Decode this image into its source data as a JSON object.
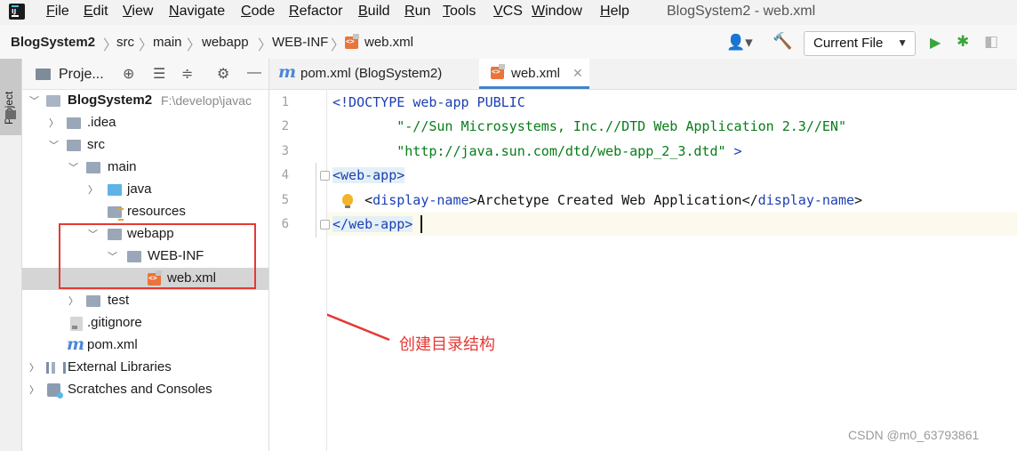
{
  "menu": {
    "items": [
      {
        "key": "F",
        "rest": "ile"
      },
      {
        "key": "E",
        "rest": "dit"
      },
      {
        "key": "V",
        "rest": "iew"
      },
      {
        "key": "N",
        "rest": "avigate"
      },
      {
        "key": "C",
        "rest": "ode"
      },
      {
        "key": "R",
        "rest": "efactor"
      },
      {
        "key": "B",
        "rest": "uild"
      },
      {
        "key": "R",
        "rest": "un"
      },
      {
        "key": "T",
        "rest": "ools"
      },
      {
        "key": "V",
        "rest": "CS"
      },
      {
        "key": "W",
        "rest": "indow"
      },
      {
        "key": "H",
        "rest": "elp"
      }
    ],
    "window_title": "BlogSystem2 - web.xml"
  },
  "breadcrumb": [
    "BlogSystem2",
    "src",
    "main",
    "webapp",
    "WEB-INF",
    "web.xml"
  ],
  "toolbar": {
    "run_config": "Current File",
    "icons": [
      "user-icon",
      "hammer-icon",
      "run-icon",
      "debug-icon",
      "profile-icon"
    ]
  },
  "tool_strip": {
    "project_label": "Project"
  },
  "project_panel": {
    "title": "Proje...",
    "header_icons": [
      "locate-icon",
      "expand-all-icon",
      "collapse-all-icon",
      "gear-icon",
      "minimize-icon"
    ],
    "tree": [
      {
        "label": "BlogSystem2",
        "path": "F:\\develop\\javac"
      },
      {
        "label": ".idea"
      },
      {
        "label": "src"
      },
      {
        "label": "main"
      },
      {
        "label": "java"
      },
      {
        "label": "resources"
      },
      {
        "label": "webapp"
      },
      {
        "label": "WEB-INF"
      },
      {
        "label": "web.xml"
      },
      {
        "label": "test"
      },
      {
        "label": ".gitignore"
      },
      {
        "label": "pom.xml"
      },
      {
        "label": "External Libraries"
      },
      {
        "label": "Scratches and Consoles"
      }
    ]
  },
  "annotation": {
    "text": "创建目录结构",
    "color": "#e53935"
  },
  "editor": {
    "tabs": [
      {
        "label": "pom.xml (BlogSystem2)",
        "active": false
      },
      {
        "label": "web.xml",
        "active": true
      }
    ],
    "line_numbers": [
      "1",
      "2",
      "3",
      "4",
      "5",
      "6"
    ],
    "code": {
      "l1_a": "<!DOCTYPE ",
      "l1_b": "web-app PUBLIC",
      "l2": "        \"-//Sun Microsystems, Inc.//DTD Web Application 2.3//EN\"",
      "l3_a": "        \"http://java.sun.com/dtd/web-app_2_3.dtd\"",
      "l3_b": " >",
      "l4_open": "<",
      "l4_name": "web-app",
      "l4_close": ">",
      "l5_indent": "    ",
      "l5_open": "<",
      "l5_name": "display-name",
      "l5_gt": ">",
      "l5_text": "Archetype Created Web Application",
      "l5_end_open": "</",
      "l5_end_name": "display-name",
      "l5_end_gt": ">",
      "l6_open": "</",
      "l6_name": "web-app",
      "l6_close": ">"
    }
  },
  "watermark": "CSDN @m0_63793861"
}
